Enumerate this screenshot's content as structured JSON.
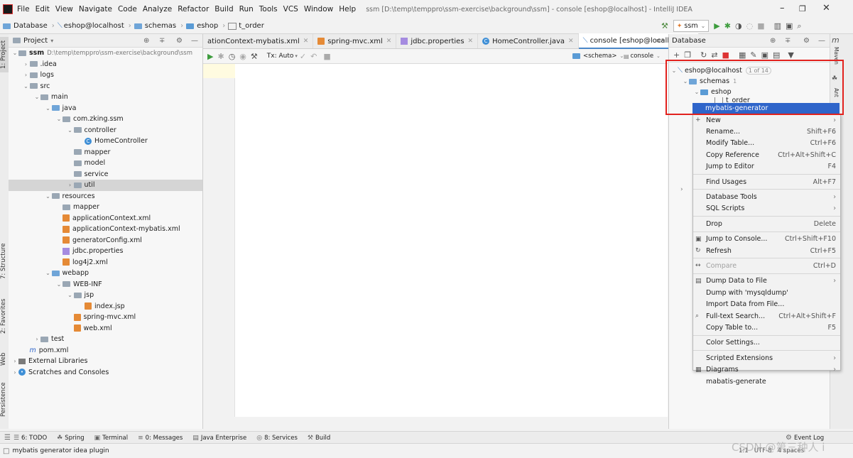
{
  "menubar": {
    "items": [
      "File",
      "Edit",
      "View",
      "Navigate",
      "Code",
      "Analyze",
      "Refactor",
      "Build",
      "Run",
      "Tools",
      "VCS",
      "Window",
      "Help"
    ],
    "title": "ssm [D:\\temp\\temppro\\ssm-exercise\\background\\ssm] - console [eshop@localhost] - IntelliJ IDEA"
  },
  "navbar": {
    "crumbs": [
      "Database",
      "eshop@localhost",
      "schemas",
      "eshop",
      "t_order"
    ],
    "run_config": "ssm"
  },
  "left_strip": {
    "tabs": [
      "1: Project",
      "7: Structure",
      "2: Favorites",
      "Web",
      "Persistence"
    ]
  },
  "project": {
    "header": "Project",
    "tree": [
      {
        "label": "ssm",
        "extra": "D:\\temp\\temppro\\ssm-exercise\\background\\ssm",
        "depth": 0,
        "arrow": "v",
        "icon": "folder"
      },
      {
        "label": ".idea",
        "depth": 1,
        "arrow": ">",
        "icon": "folder"
      },
      {
        "label": "logs",
        "depth": 1,
        "arrow": ">",
        "icon": "folder"
      },
      {
        "label": "src",
        "depth": 1,
        "arrow": "v",
        "icon": "folder"
      },
      {
        "label": "main",
        "depth": 2,
        "arrow": "v",
        "icon": "folder"
      },
      {
        "label": "java",
        "depth": 3,
        "arrow": "v",
        "icon": "folder-blue"
      },
      {
        "label": "com.zking.ssm",
        "depth": 4,
        "arrow": "v",
        "icon": "folder"
      },
      {
        "label": "controller",
        "depth": 5,
        "arrow": "v",
        "icon": "folder"
      },
      {
        "label": "HomeController",
        "depth": 6,
        "arrow": "",
        "icon": "class"
      },
      {
        "label": "mapper",
        "depth": 5,
        "arrow": "",
        "icon": "folder"
      },
      {
        "label": "model",
        "depth": 5,
        "arrow": "",
        "icon": "folder"
      },
      {
        "label": "service",
        "depth": 5,
        "arrow": "",
        "icon": "folder"
      },
      {
        "label": "util",
        "depth": 5,
        "arrow": ">",
        "icon": "folder",
        "selected": true
      },
      {
        "label": "resources",
        "depth": 3,
        "arrow": "v",
        "icon": "folder"
      },
      {
        "label": "mapper",
        "depth": 4,
        "arrow": "",
        "icon": "folder"
      },
      {
        "label": "applicationContext.xml",
        "depth": 4,
        "arrow": "",
        "icon": "xml"
      },
      {
        "label": "applicationContext-mybatis.xml",
        "depth": 4,
        "arrow": "",
        "icon": "xml"
      },
      {
        "label": "generatorConfig.xml",
        "depth": 4,
        "arrow": "",
        "icon": "xml"
      },
      {
        "label": "jdbc.properties",
        "depth": 4,
        "arrow": "",
        "icon": "prop"
      },
      {
        "label": "log4j2.xml",
        "depth": 4,
        "arrow": "",
        "icon": "xml"
      },
      {
        "label": "webapp",
        "depth": 3,
        "arrow": "v",
        "icon": "folder-blue"
      },
      {
        "label": "WEB-INF",
        "depth": 4,
        "arrow": "v",
        "icon": "folder"
      },
      {
        "label": "jsp",
        "depth": 5,
        "arrow": "v",
        "icon": "folder"
      },
      {
        "label": "index.jsp",
        "depth": 6,
        "arrow": "",
        "icon": "xml"
      },
      {
        "label": "spring-mvc.xml",
        "depth": 5,
        "arrow": "",
        "icon": "xml"
      },
      {
        "label": "web.xml",
        "depth": 5,
        "arrow": "",
        "icon": "xml"
      },
      {
        "label": "test",
        "depth": 2,
        "arrow": ">",
        "icon": "folder"
      },
      {
        "label": "pom.xml",
        "depth": 1,
        "arrow": "",
        "icon": "pom"
      },
      {
        "label": "External Libraries",
        "depth": 0,
        "arrow": ">",
        "icon": "lib"
      },
      {
        "label": "Scratches and Consoles",
        "depth": 0,
        "arrow": ">",
        "icon": "scratch"
      }
    ]
  },
  "editor": {
    "tabs": [
      {
        "label": "ationContext-mybatis.xml",
        "active": false
      },
      {
        "label": "spring-mvc.xml",
        "active": false
      },
      {
        "label": "jdbc.properties",
        "active": false
      },
      {
        "label": "HomeController.java",
        "active": false
      },
      {
        "label": "console [eshop@localhost]",
        "active": true
      }
    ],
    "tab_overflow": "≡s",
    "tx_label": "Tx: Auto",
    "schema_label": "<schema>",
    "console_label": "console"
  },
  "database": {
    "header": "Database",
    "tree": [
      {
        "label": "eshop@localhost",
        "badge": "1 of 14"
      },
      {
        "label": "schemas",
        "badge": "1"
      },
      {
        "label": "eshop",
        "badge": ""
      },
      {
        "label": "t_order",
        "badge": ""
      }
    ],
    "side_tabs": [
      "Maven",
      "Ant"
    ]
  },
  "context_menu": {
    "selected": "mybatis-generator",
    "items": [
      {
        "label": "New",
        "sub": true,
        "icon": "+"
      },
      {
        "label": "Rename...",
        "shortcut": "Shift+F6"
      },
      {
        "label": "Modify Table...",
        "shortcut": "Ctrl+F6"
      },
      {
        "label": "Copy Reference",
        "shortcut": "Ctrl+Alt+Shift+C"
      },
      {
        "label": "Jump to Editor",
        "shortcut": "F4"
      },
      {
        "sep": true
      },
      {
        "label": "Find Usages",
        "shortcut": "Alt+F7"
      },
      {
        "sep": true
      },
      {
        "label": "Database Tools",
        "sub": true
      },
      {
        "label": "SQL Scripts",
        "sub": true
      },
      {
        "sep": true
      },
      {
        "label": "Drop",
        "shortcut": "Delete"
      },
      {
        "sep": true
      },
      {
        "label": "Jump to Console...",
        "shortcut": "Ctrl+Shift+F10",
        "icon": "▣"
      },
      {
        "label": "Refresh",
        "shortcut": "Ctrl+F5",
        "icon": "↻"
      },
      {
        "sep": true
      },
      {
        "label": "Compare",
        "shortcut": "Ctrl+D",
        "disabled": true,
        "icon": "↔"
      },
      {
        "sep": true
      },
      {
        "label": "Dump Data to File",
        "sub": true,
        "icon": "▤"
      },
      {
        "label": "Dump with 'mysqldump'"
      },
      {
        "label": "Import Data from File..."
      },
      {
        "label": "Full-text Search...",
        "shortcut": "Ctrl+Alt+Shift+F",
        "icon": "⌕"
      },
      {
        "label": "Copy Table to...",
        "shortcut": "F5"
      },
      {
        "sep": true
      },
      {
        "label": "Color Settings..."
      },
      {
        "sep": true
      },
      {
        "label": "Scripted Extensions",
        "sub": true
      },
      {
        "label": "Diagrams",
        "sub": true,
        "icon": "▦"
      },
      {
        "label": "mabatis-generate"
      }
    ]
  },
  "bottom": {
    "tabs": [
      "6: TODO",
      "Spring",
      "Terminal",
      "0: Messages",
      "Java Enterprise",
      "8: Services",
      "Build"
    ],
    "event_log": "Event Log",
    "status_left": "mybatis generator idea plugin",
    "status_right": "1:1   UTF-8   4 spaces",
    "watermark": "CSDN @第三种人 i"
  },
  "colors": {
    "selection": "#2f65ca",
    "highlight_box": "#e2221e",
    "tree_selected": "#d5d5d5"
  }
}
